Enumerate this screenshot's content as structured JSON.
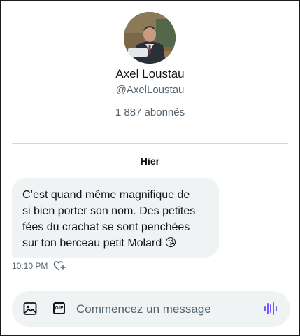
{
  "profile": {
    "name": "Axel Loustau",
    "handle": "@AxelLoustau",
    "followers": "1 887 abonnés"
  },
  "conversation": {
    "day_label": "Hier",
    "messages": [
      {
        "text": "C’est quand même magnifique de\nsi bien porter son nom. Des petites\nfées du crachat se sont penchées\nsur ton berceau petit Molard 😘",
        "time": "10:10 PM"
      }
    ]
  },
  "composer": {
    "placeholder": "Commencez un message",
    "gif_label": "GIF"
  },
  "icons": {
    "media": "image-icon",
    "gif": "gif-icon",
    "voice": "voice-wave-icon",
    "reaction": "add-reaction-heart-icon"
  },
  "colors": {
    "accent": "#7856ff",
    "bubble": "#eff3f4",
    "secondary_text": "#536471",
    "divider": "#cfd9de"
  }
}
